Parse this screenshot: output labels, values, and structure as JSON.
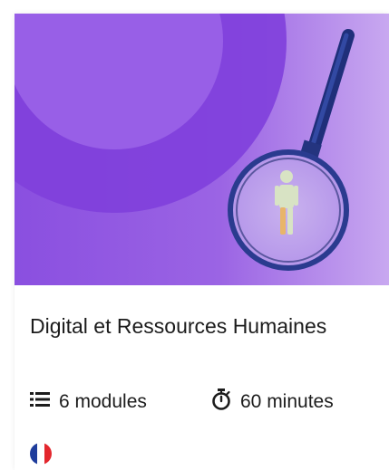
{
  "course": {
    "title": "Digital et Ressources Humaines",
    "modules_label": "6 modules",
    "duration_label": "60 minutes"
  },
  "icons": {
    "modules": "list-icon",
    "duration": "stopwatch-icon",
    "language": "french-flag-icon",
    "hero": "magnifying-glass-person-illustration"
  },
  "colors": {
    "hero_purple": "#8a4fe0",
    "hero_light": "#c8a8f0",
    "lens_blue": "#2a3b8f",
    "flag_blue": "#1f3d9c",
    "flag_white": "#ffffff",
    "flag_red": "#e3262d"
  }
}
